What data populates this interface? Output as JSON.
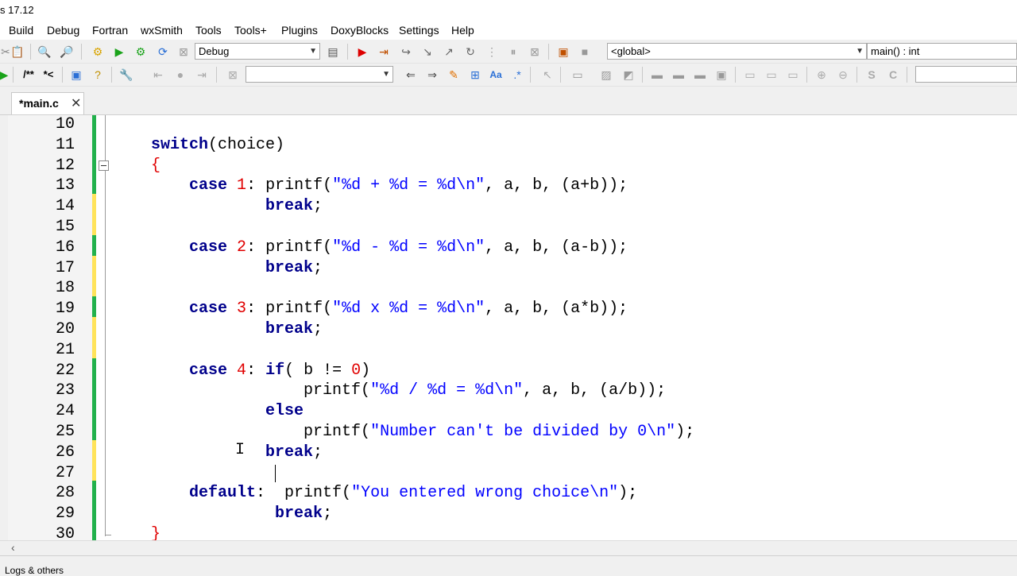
{
  "window": {
    "title_fragment": "s 17.12"
  },
  "menu": [
    "Build",
    "Debug",
    "Fortran",
    "wxSmith",
    "Tools",
    "Tools+",
    "Plugins",
    "DoxyBlocks",
    "Settings",
    "Help"
  ],
  "toolbar": {
    "build_target": "Debug",
    "scope": "<global>",
    "symbol": "main() : int",
    "doxy_comment": "/**",
    "doxy_line": "*<"
  },
  "tabs": [
    {
      "label": "*main.c",
      "close": "✕"
    }
  ],
  "editor": {
    "line_numbers": [
      "10",
      "11",
      "12",
      "13",
      "14",
      "15",
      "16",
      "17",
      "18",
      "19",
      "20",
      "21",
      "22",
      "23",
      "24",
      "25",
      "26",
      "27",
      "28",
      "29",
      "30"
    ],
    "code": [
      {
        "line": 10,
        "tokens": []
      },
      {
        "line": 11,
        "tokens": [
          {
            "t": "    ",
            "c": ""
          },
          {
            "t": "switch",
            "c": "kw"
          },
          {
            "t": "(choice)",
            "c": ""
          }
        ]
      },
      {
        "line": 12,
        "tokens": [
          {
            "t": "    ",
            "c": ""
          },
          {
            "t": "{",
            "c": "op"
          }
        ]
      },
      {
        "line": 13,
        "tokens": [
          {
            "t": "        ",
            "c": ""
          },
          {
            "t": "case",
            "c": "kw"
          },
          {
            "t": " ",
            "c": ""
          },
          {
            "t": "1",
            "c": "nu"
          },
          {
            "t": ": printf(",
            "c": ""
          },
          {
            "t": "\"%d + %d = %d\\n\"",
            "c": "st"
          },
          {
            "t": ", a, b, (a+b));",
            "c": ""
          }
        ]
      },
      {
        "line": 14,
        "tokens": [
          {
            "t": "                ",
            "c": ""
          },
          {
            "t": "break",
            "c": "kw"
          },
          {
            "t": ";",
            "c": ""
          }
        ]
      },
      {
        "line": 15,
        "tokens": []
      },
      {
        "line": 16,
        "tokens": [
          {
            "t": "        ",
            "c": ""
          },
          {
            "t": "case",
            "c": "kw"
          },
          {
            "t": " ",
            "c": ""
          },
          {
            "t": "2",
            "c": "nu"
          },
          {
            "t": ": printf(",
            "c": ""
          },
          {
            "t": "\"%d - %d = %d\\n\"",
            "c": "st"
          },
          {
            "t": ", a, b, (a-b));",
            "c": ""
          }
        ]
      },
      {
        "line": 17,
        "tokens": [
          {
            "t": "                ",
            "c": ""
          },
          {
            "t": "break",
            "c": "kw"
          },
          {
            "t": ";",
            "c": ""
          }
        ]
      },
      {
        "line": 18,
        "tokens": []
      },
      {
        "line": 19,
        "tokens": [
          {
            "t": "        ",
            "c": ""
          },
          {
            "t": "case",
            "c": "kw"
          },
          {
            "t": " ",
            "c": ""
          },
          {
            "t": "3",
            "c": "nu"
          },
          {
            "t": ": printf(",
            "c": ""
          },
          {
            "t": "\"%d x %d = %d\\n\"",
            "c": "st"
          },
          {
            "t": ", a, b, (a*b));",
            "c": ""
          }
        ]
      },
      {
        "line": 20,
        "tokens": [
          {
            "t": "                ",
            "c": ""
          },
          {
            "t": "break",
            "c": "kw"
          },
          {
            "t": ";",
            "c": ""
          }
        ]
      },
      {
        "line": 21,
        "tokens": []
      },
      {
        "line": 22,
        "tokens": [
          {
            "t": "        ",
            "c": ""
          },
          {
            "t": "case",
            "c": "kw"
          },
          {
            "t": " ",
            "c": ""
          },
          {
            "t": "4",
            "c": "nu"
          },
          {
            "t": ": ",
            "c": ""
          },
          {
            "t": "if",
            "c": "kw"
          },
          {
            "t": "( b != ",
            "c": ""
          },
          {
            "t": "0",
            "c": "nu"
          },
          {
            "t": ")",
            "c": ""
          }
        ]
      },
      {
        "line": 23,
        "tokens": [
          {
            "t": "                    printf(",
            "c": ""
          },
          {
            "t": "\"%d / %d = %d\\n\"",
            "c": "st"
          },
          {
            "t": ", a, b, (a/b));",
            "c": ""
          }
        ]
      },
      {
        "line": 24,
        "tokens": [
          {
            "t": "                ",
            "c": ""
          },
          {
            "t": "else",
            "c": "kw"
          }
        ]
      },
      {
        "line": 25,
        "tokens": [
          {
            "t": "                    printf(",
            "c": ""
          },
          {
            "t": "\"Number can't be divided by 0\\n\"",
            "c": "st"
          },
          {
            "t": ");",
            "c": ""
          }
        ]
      },
      {
        "line": 26,
        "tokens": [
          {
            "t": "                ",
            "c": ""
          },
          {
            "t": "break",
            "c": "kw"
          },
          {
            "t": ";",
            "c": ""
          }
        ]
      },
      {
        "line": 27,
        "tokens": []
      },
      {
        "line": 28,
        "tokens": [
          {
            "t": "        ",
            "c": ""
          },
          {
            "t": "default",
            "c": "kw"
          },
          {
            "t": ":  printf(",
            "c": ""
          },
          {
            "t": "\"You entered wrong choice\\n\"",
            "c": "st"
          },
          {
            "t": ");",
            "c": ""
          }
        ]
      },
      {
        "line": 29,
        "tokens": [
          {
            "t": "                 ",
            "c": ""
          },
          {
            "t": "break",
            "c": "kw"
          },
          {
            "t": ";",
            "c": ""
          }
        ]
      },
      {
        "line": 30,
        "tokens": [
          {
            "t": "    ",
            "c": ""
          },
          {
            "t": "}",
            "c": "op"
          }
        ]
      }
    ],
    "change_markers": [
      "green",
      "green",
      "green",
      "green",
      "yellow",
      "yellow",
      "green",
      "yellow",
      "yellow",
      "green",
      "yellow",
      "yellow",
      "green",
      "green",
      "green",
      "green",
      "yellow",
      "yellow",
      "green",
      "green",
      "green"
    ]
  },
  "status": {
    "text": "Logs & others"
  },
  "colors": {
    "saved_change": "#22b14c",
    "unsaved_change": "#ffe35a"
  }
}
